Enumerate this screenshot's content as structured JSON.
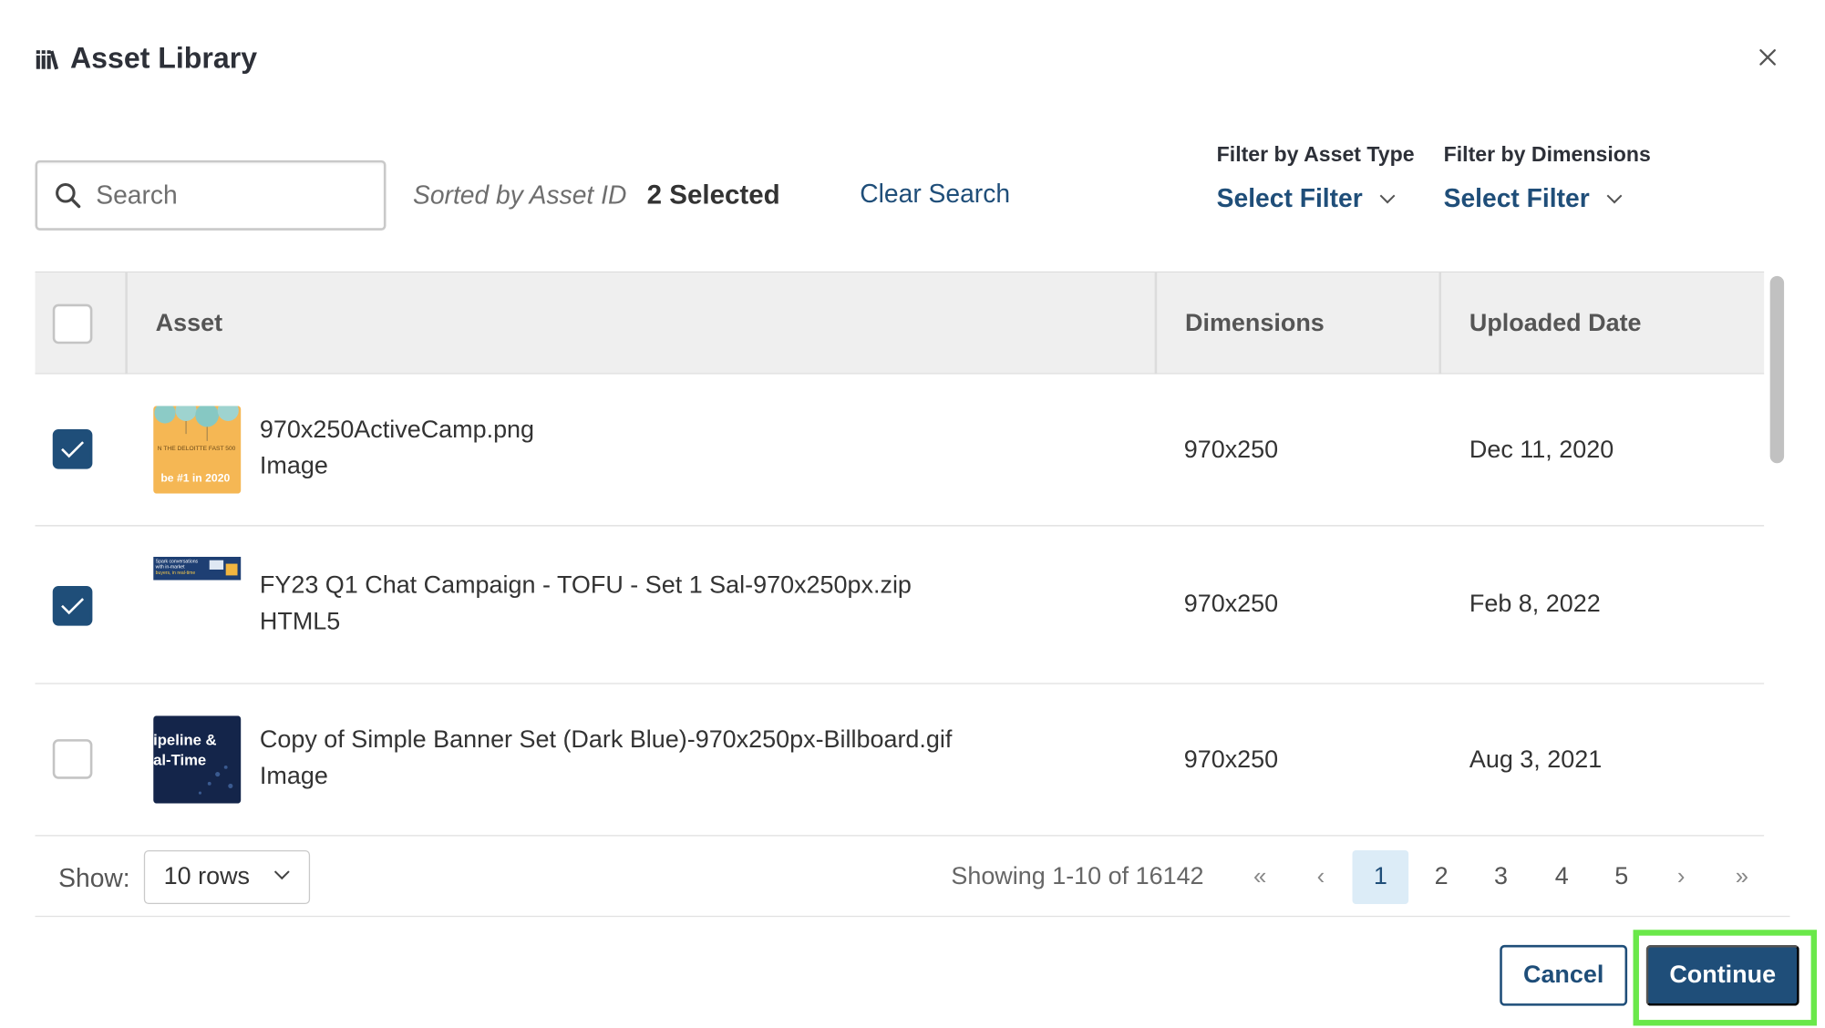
{
  "modal": {
    "title": "Asset Library",
    "close_symbol": "×"
  },
  "toolbar": {
    "search_placeholder": "Search",
    "sorted_by": "Sorted by Asset ID",
    "selected_count": "2 Selected",
    "clear_search": "Clear Search",
    "filters": [
      {
        "label": "Filter by Asset Type",
        "value": "Select Filter"
      },
      {
        "label": "Filter by Dimensions",
        "value": "Select Filter"
      }
    ]
  },
  "table": {
    "columns": [
      "Asset",
      "Dimensions",
      "Uploaded Date"
    ],
    "rows": [
      {
        "checked": true,
        "name": "970x250ActiveCamp.png",
        "type": "Image",
        "dimensions": "970x250",
        "date": "Dec 11, 2020",
        "thumb": "orange-balloons",
        "thumb_texts": [
          "N THE DELOITTE FAST 500",
          "be #1 in 2020"
        ]
      },
      {
        "checked": true,
        "name": "FY23 Q1 Chat Campaign - TOFU - Set 1 Sal-970x250px.zip",
        "type": "HTML5",
        "dimensions": "970x250",
        "date": "Feb 8, 2022",
        "thumb": "blue-banner-strip",
        "thumb_texts": [
          "Spark conversations",
          "with in-market",
          "buyers, in real-time"
        ]
      },
      {
        "checked": false,
        "name": "Copy of Simple Banner Set (Dark Blue)-970x250px-Billboard.gif",
        "type": "Image",
        "dimensions": "970x250",
        "date": "Aug 3, 2021",
        "thumb": "dark-blue-dots",
        "thumb_texts": [
          "ipeline &",
          "al-Time"
        ]
      }
    ]
  },
  "footer": {
    "show_label": "Show:",
    "rows_option": "10 rows",
    "showing": "Showing 1-10 of 16142",
    "pages": [
      "1",
      "2",
      "3",
      "4",
      "5"
    ],
    "current_page": "1",
    "first_symbol": "«",
    "prev_symbol": "‹",
    "next_symbol": "›",
    "last_symbol": "»"
  },
  "actions": {
    "cancel": "Cancel",
    "continue": "Continue"
  },
  "colors": {
    "primary": "#1f4e79",
    "highlight": "#6ae84a",
    "active_page_bg": "#dcecf7"
  }
}
